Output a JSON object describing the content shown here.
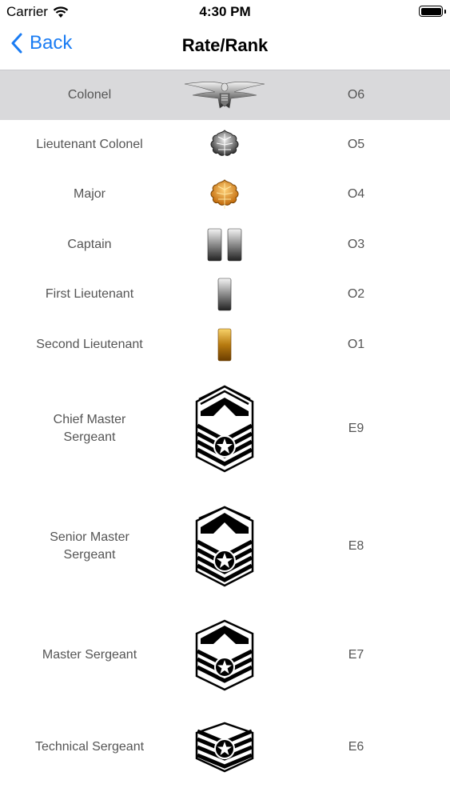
{
  "status": {
    "carrier": "Carrier",
    "time": "4:30 PM"
  },
  "nav": {
    "back_label": "Back",
    "title": "Rate/Rank"
  },
  "ranks": [
    {
      "name": "Colonel",
      "code": "O6",
      "icon": "eagle-insignia-icon",
      "selected": true
    },
    {
      "name": "Lieutenant Colonel",
      "code": "O5",
      "icon": "silver-oak-leaf-icon"
    },
    {
      "name": "Major",
      "code": "O4",
      "icon": "gold-oak-leaf-icon"
    },
    {
      "name": "Captain",
      "code": "O3",
      "icon": "double-silver-bar-icon"
    },
    {
      "name": "First Lieutenant",
      "code": "O2",
      "icon": "silver-bar-icon"
    },
    {
      "name": "Second Lieutenant",
      "code": "O1",
      "icon": "gold-bar-icon"
    },
    {
      "name": "Chief Master\nSergeant",
      "code": "E9",
      "icon": "chief-master-sergeant-chevron-icon"
    },
    {
      "name": "Senior Master\nSergeant",
      "code": "E8",
      "icon": "senior-master-sergeant-chevron-icon"
    },
    {
      "name": "Master Sergeant",
      "code": "E7",
      "icon": "master-sergeant-chevron-icon"
    },
    {
      "name": "Technical Sergeant",
      "code": "E6",
      "icon": "technical-sergeant-chevron-icon"
    }
  ],
  "colors": {
    "accent": "#1a7cf3",
    "selected_row": "#d9d9db",
    "text": "#555555"
  }
}
